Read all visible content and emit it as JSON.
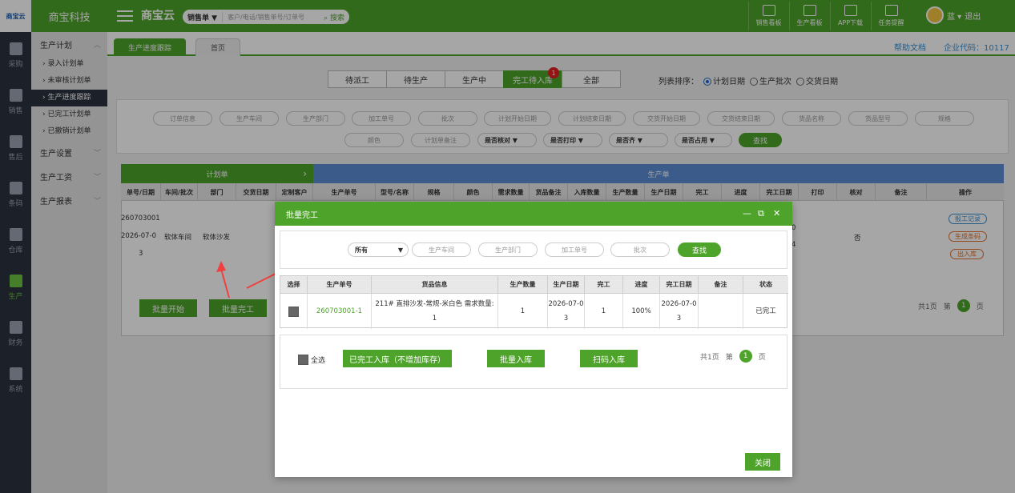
{
  "header": {
    "logo_text": "商宝云",
    "company": "商宝科技",
    "brand": "商宝云",
    "search": {
      "type": "销售单 ▼",
      "placeholder": "客户/电话/销售单号/订单号",
      "button": "搜索"
    },
    "tools": [
      "销售看板",
      "生产看板",
      "APP下载",
      "任务提醒"
    ],
    "user": "蓝 ▾",
    "logout": "退出"
  },
  "rail": [
    "采购",
    "销售",
    "售后",
    "条码",
    "仓库",
    "生产",
    "财务",
    "系统"
  ],
  "submenu": {
    "section1": "生产计划",
    "items": [
      "› 录入计划单",
      "› 未审核计划单",
      "› 生产进度跟踪",
      "› 已完工计划单",
      "› 已撤销计划单"
    ],
    "section2": "生产设置",
    "section3": "生产工资",
    "section4": "生产报表"
  },
  "tabs": {
    "active": "生产进度跟踪",
    "home": "首页"
  },
  "help": "帮助文档",
  "corp_code": "企业代码：10117",
  "status_tabs": [
    "待派工",
    "待生产",
    "生产中",
    "完工待入库",
    "全部"
  ],
  "status_badge": "1",
  "sort": {
    "label": "列表排序：",
    "options": [
      "计划日期",
      "生产批次",
      "交货日期"
    ]
  },
  "filters": {
    "row1": [
      "订单信息",
      "生产车间",
      "生产部门",
      "加工单号",
      "批次",
      "计划开始日期",
      "计划结束日期",
      "交货开始日期",
      "交货结束日期",
      "货品名称",
      "货品型号",
      "规格"
    ],
    "row2": [
      "颜色",
      "计划单备注"
    ],
    "selects": [
      "是否核对 ▼",
      "是否打印 ▼",
      "是否齐 ▼",
      "是否占用 ▼"
    ],
    "search": "查找"
  },
  "table": {
    "group_plan": "计划单",
    "group_plan_arrow": "›",
    "group_prod": "生产单",
    "headers": [
      "单号/日期",
      "车间/批次",
      "部门",
      "交货日期",
      "定制客户",
      "生产单号",
      "型号/名称",
      "规格",
      "颜色",
      "需求数量",
      "货品备注",
      "入库数量",
      "生产数量",
      "生产日期",
      "完工",
      "进度",
      "完工日期",
      "打印",
      "核对",
      "备注",
      "操作"
    ],
    "row": {
      "order_no": "260703001",
      "date_a": "2026-07-0",
      "date_b": "3",
      "workshop": "软体车间",
      "dept": "软体沙发",
      "check": "否",
      "frag1": "0",
      "frag2": "4"
    },
    "ops": [
      "报工记录",
      "生成条码",
      "出入库"
    ],
    "bulk_start": "批量开始",
    "bulk_done": "批量完工",
    "pager": {
      "total": "共1页",
      "page_label": "第",
      "page": "1",
      "page_suffix": "页"
    }
  },
  "modal": {
    "title": "批量完工",
    "filter": {
      "select": "所有",
      "placeholders": [
        "生产车间",
        "生产部门",
        "加工单号",
        "批次"
      ],
      "search": "查找"
    },
    "headers": [
      "选择",
      "生产单号",
      "货品信息",
      "生产数量",
      "生产日期",
      "完工",
      "进度",
      "完工日期",
      "备注",
      "状态"
    ],
    "row": {
      "prod_no": "260703001-1",
      "info1": "211# 直排沙发-常规-米白色 需求数量:",
      "info2": "1",
      "qty": "1",
      "date_a": "2026-07-0",
      "date_b": "3",
      "done": "1",
      "progress": "100%",
      "done_date_a": "2026-07-0",
      "done_date_b": "3",
      "status": "已完工"
    },
    "select_all": "全选",
    "btn_done_in": "已完工入库（不增加库存）",
    "btn_bulk_in": "批量入库",
    "btn_scan_in": "扫码入库",
    "pager": {
      "total": "共1页",
      "page_label": "第",
      "page": "1",
      "page_suffix": "页"
    },
    "close": "关闭"
  },
  "colors": {
    "primary": "#4ea32a",
    "blue": "#5b8dd6",
    "badge": "#e02020",
    "arrow": "#f04040"
  }
}
